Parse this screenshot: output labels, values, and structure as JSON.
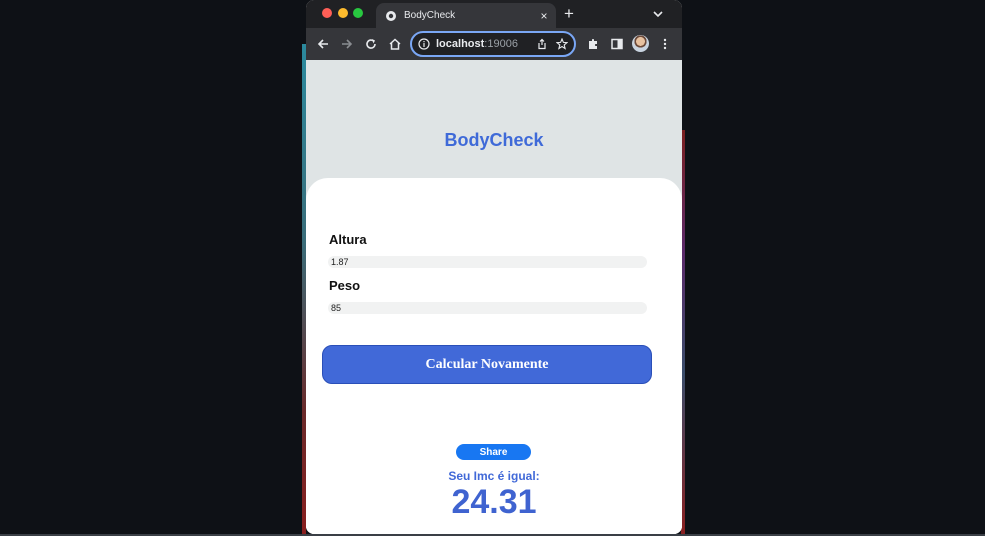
{
  "browser": {
    "tab_title": "BodyCheck",
    "tab_close": "×",
    "new_tab": "+",
    "url_host": "localhost",
    "url_port": ":19006"
  },
  "app": {
    "title": "BodyCheck",
    "height_label": "Altura",
    "height_value": "1.87",
    "weight_label": "Peso",
    "weight_value": "85",
    "recalculate_label": "Calcular Novamente",
    "share_label": "Share",
    "result_label": "Seu Imc é igual:",
    "result_value": "24.31"
  },
  "colors": {
    "accent": "#4169d8",
    "share": "#1877f2",
    "page_bg": "#dfe4e5"
  },
  "icons": [
    "chrome-favicon",
    "close-icon",
    "plus-icon",
    "chevron-down-icon",
    "back-arrow-icon",
    "forward-arrow-icon",
    "reload-icon",
    "home-icon",
    "info-icon",
    "share-icon",
    "star-icon",
    "extensions-icon",
    "sidepanel-icon",
    "profile-avatar",
    "more-icon"
  ]
}
